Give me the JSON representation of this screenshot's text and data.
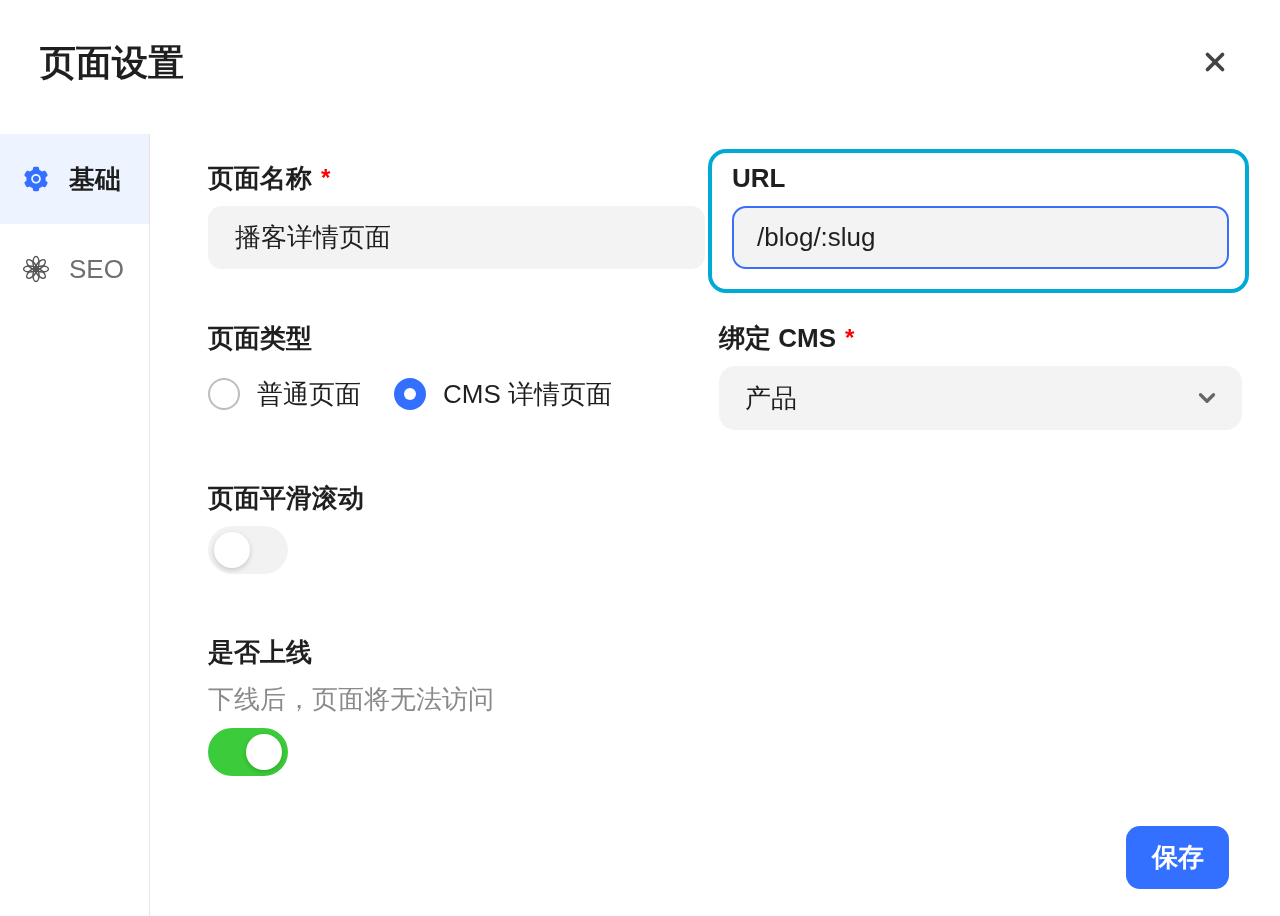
{
  "dialog": {
    "title": "页面设置"
  },
  "sidebar": {
    "items": [
      {
        "label": "基础",
        "selected": true
      },
      {
        "label": "SEO",
        "selected": false
      }
    ]
  },
  "form": {
    "page_name": {
      "label": "页面名称",
      "required_mark": "*",
      "value": "播客详情页面",
      "focused": false
    },
    "url": {
      "label": "URL",
      "value": "/blog/:slug",
      "focused": true,
      "highlighted": true
    },
    "page_type": {
      "label": "页面类型",
      "options": [
        {
          "label": "普通页面",
          "selected": false
        },
        {
          "label": "CMS 详情页面",
          "selected": true
        }
      ]
    },
    "bind_cms": {
      "label": "绑定 CMS",
      "required_mark": "*",
      "value": "产品"
    },
    "smooth_scroll": {
      "label": "页面平滑滚动",
      "on": false
    },
    "online": {
      "label": "是否上线",
      "description": "下线后，页面将无法访问",
      "on": true
    }
  },
  "save_button": {
    "label": "保存"
  }
}
